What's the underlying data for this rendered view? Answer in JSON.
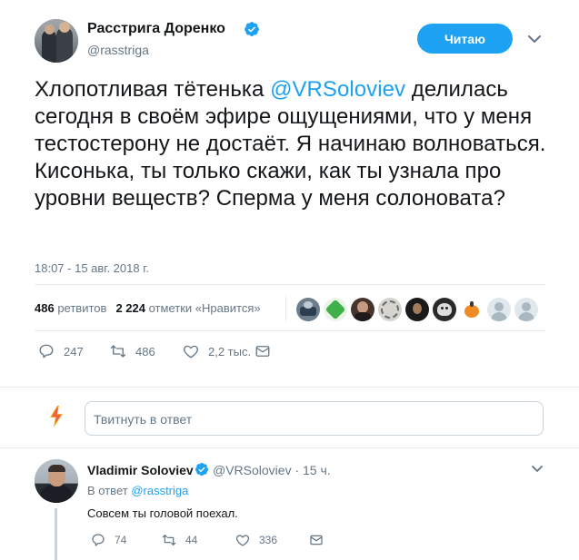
{
  "tweet": {
    "author": {
      "display_name": "Расстрига Доренко",
      "handle": "@rasstriga",
      "verified": true
    },
    "follow_button": "Читаю",
    "text_before_mention": "Хлопотливая тётенька ",
    "mention": "@VRSoloviev",
    "text_after_mention": " делилась сегодня в своём эфире ощущениями, что у меня тестостерону не достаёт. Я начинаю волноваться. Кисонька, ты только скажи, как ты узнала про уровни веществ? Сперма у меня солоновата?",
    "timestamp": "18:07 - 15 авг. 2018 г.",
    "stats": {
      "retweets_count": "486",
      "retweets_label": "ретвитов",
      "likes_count": "2 224",
      "likes_label": "отметки «Нравится»"
    },
    "actions": {
      "reply_count": "247",
      "retweet_count": "486",
      "like_count": "2,2 тыс."
    }
  },
  "reply_box": {
    "placeholder": "Твитнуть в ответ"
  },
  "reply": {
    "author": {
      "display_name": "Vladimir Soloviev",
      "verified": true
    },
    "meta": "@VRSoloviev · 15 ч.",
    "reply_to_label": "В ответ ",
    "reply_to_handle": "@rasstriga",
    "text": "Совсем ты головой поехал.",
    "actions": {
      "reply_count": "74",
      "retweet_count": "44",
      "like_count": "336"
    }
  },
  "colors": {
    "accent": "#1da1f2",
    "muted": "#657786",
    "text": "#14171a"
  },
  "icons": [
    "verified-icon",
    "chevron-down-icon",
    "reply-icon",
    "retweet-icon",
    "like-icon",
    "message-icon",
    "lightning-icon"
  ]
}
